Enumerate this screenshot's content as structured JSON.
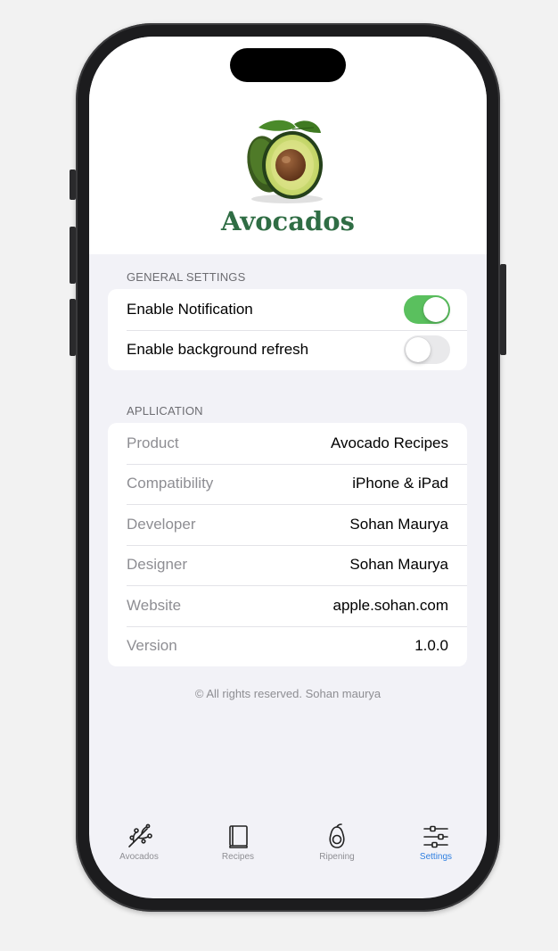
{
  "app": {
    "title": "Avocados"
  },
  "general_settings": {
    "header": "GENERAL SETTINGS",
    "rows": [
      {
        "label": "Enable Notification",
        "enabled": true
      },
      {
        "label": "Enable background refresh",
        "enabled": false
      }
    ]
  },
  "application": {
    "header": "APLLICATION",
    "rows": [
      {
        "label": "Product",
        "value": "Avocado Recipes"
      },
      {
        "label": "Compatibility",
        "value": "iPhone & iPad"
      },
      {
        "label": "Developer",
        "value": "Sohan Maurya"
      },
      {
        "label": "Designer",
        "value": "Sohan Maurya"
      },
      {
        "label": "Website",
        "value": "apple.sohan.com"
      },
      {
        "label": "Version",
        "value": "1.0.0"
      }
    ]
  },
  "footer": {
    "copyright": "© All rights reserved. Sohan maurya"
  },
  "tabbar": {
    "items": [
      {
        "label": "Avocados",
        "icon": "branch-icon",
        "active": false
      },
      {
        "label": "Recipes",
        "icon": "book-icon",
        "active": false
      },
      {
        "label": "Ripening",
        "icon": "avocado-icon",
        "active": false
      },
      {
        "label": "Settings",
        "icon": "sliders-icon",
        "active": true
      }
    ]
  },
  "colors": {
    "brand_green": "#2f6d44",
    "toggle_on": "#5ac05e",
    "tab_active": "#2f7fe0"
  }
}
